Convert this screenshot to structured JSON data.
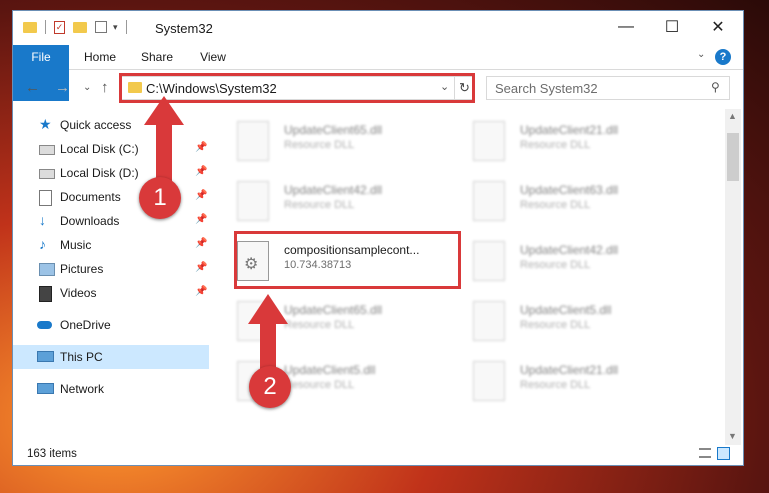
{
  "window": {
    "title": "System32",
    "controls": {
      "minimize": "—",
      "maximize": "☐",
      "close": "✕"
    }
  },
  "ribbon": {
    "tabs": [
      "File",
      "Home",
      "Share",
      "View"
    ]
  },
  "address": {
    "path": "C:\\Windows\\System32",
    "search_placeholder": "Search System32"
  },
  "sidebar": {
    "items": [
      {
        "label": "Quick access",
        "icon": "star-icon",
        "pinned": false
      },
      {
        "label": "Local Disk (C:)",
        "icon": "drive-icon",
        "pinned": true
      },
      {
        "label": "Local Disk (D:)",
        "icon": "drive-icon",
        "pinned": true
      },
      {
        "label": "Documents",
        "icon": "documents-icon",
        "pinned": true
      },
      {
        "label": "Downloads",
        "icon": "download-icon",
        "pinned": true
      },
      {
        "label": "Music",
        "icon": "music-icon",
        "pinned": true
      },
      {
        "label": "Pictures",
        "icon": "pictures-icon",
        "pinned": true
      },
      {
        "label": "Videos",
        "icon": "videos-icon",
        "pinned": true
      },
      {
        "label": "OneDrive",
        "icon": "cloud-icon",
        "pinned": false
      },
      {
        "label": "This PC",
        "icon": "computer-icon",
        "pinned": false
      },
      {
        "label": "Network",
        "icon": "network-icon",
        "pinned": false
      }
    ]
  },
  "files": {
    "left": [
      {
        "name": "UpdateClient65.dll",
        "desc": "Resource DLL"
      },
      {
        "name": "UpdateClient42.dll",
        "desc": "Resource DLL"
      },
      {
        "name": "compositionsamplecont...",
        "desc": "10.734.38713"
      },
      {
        "name": "UpdateClient65.dll",
        "desc": "Resource DLL"
      },
      {
        "name": "UpdateClient5.dll",
        "desc": "Resource DLL"
      }
    ],
    "right": [
      {
        "name": "UpdateClient21.dll",
        "desc": "Resource DLL"
      },
      {
        "name": "UpdateClient63.dll",
        "desc": "Resource DLL"
      },
      {
        "name": "UpdateClient42.dll",
        "desc": "Resource DLL"
      },
      {
        "name": "UpdateClient5.dll",
        "desc": "Resource DLL"
      },
      {
        "name": "UpdateClient21.dll",
        "desc": "Resource DLL"
      }
    ]
  },
  "status": {
    "item_count": "163 items"
  },
  "markers": {
    "one": "1",
    "two": "2"
  },
  "colors": {
    "highlight": "#d9393a",
    "file_tab": "#1979ca",
    "selected_nav": "#cce8ff"
  }
}
